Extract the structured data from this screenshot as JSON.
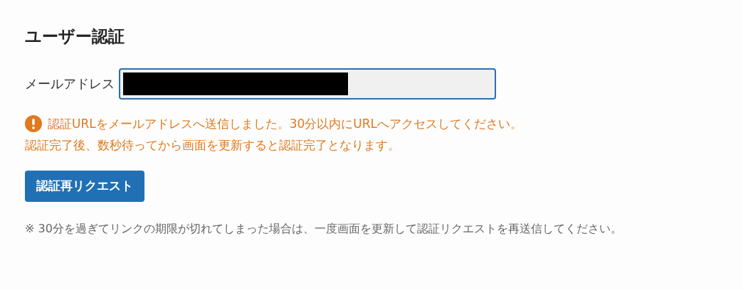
{
  "title": "ユーザー認証",
  "email_field": {
    "label": "メールアドレス",
    "redacted": true
  },
  "notice": {
    "kind": "warning",
    "lines": [
      "認証URLをメールアドレスへ送信しました。30分以内にURLへアクセスしてください。",
      "認証完了後、数秒待ってから画面を更新すると認証完了となります。"
    ]
  },
  "button": {
    "label": "認証再リクエスト"
  },
  "footnote": "※ 30分を過ぎてリンクの期限が切れてしまった場合は、一度画面を更新して認証リクエストを再送信してください。"
}
